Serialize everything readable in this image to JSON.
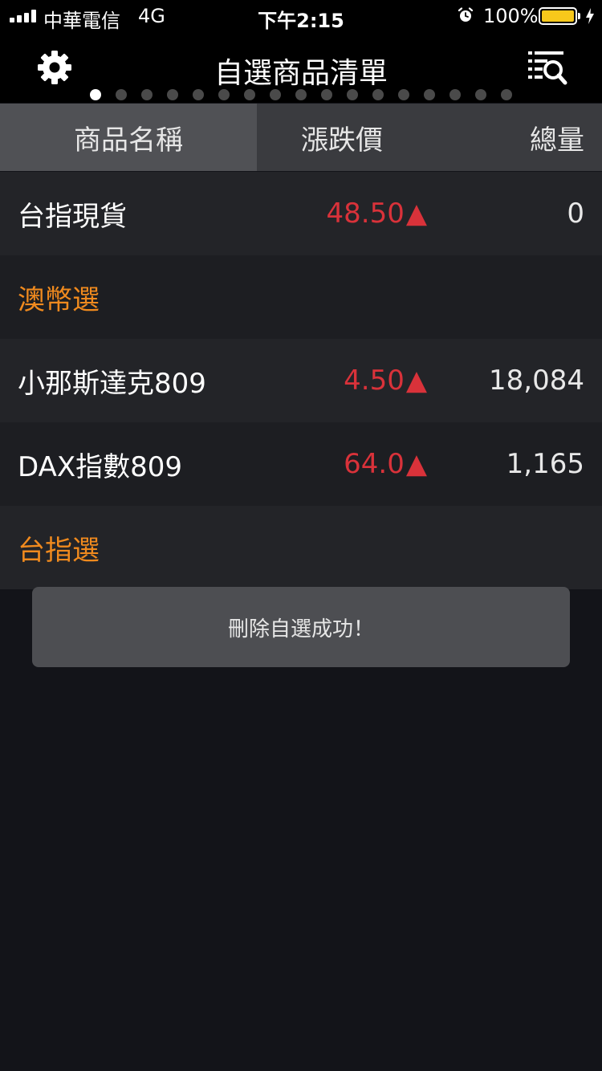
{
  "status_bar": {
    "carrier": "中華電信",
    "network": "4G",
    "time": "下午2:15",
    "battery_percent": "100%",
    "battery_color": "#f7c81b",
    "icons": [
      "signal-icon",
      "alarm-icon",
      "battery-icon",
      "charging-bolt-icon"
    ]
  },
  "nav": {
    "title": "自選商品清單",
    "left_icon": "gear-icon",
    "right_icon": "search-list-icon",
    "page_count": 17,
    "active_page": 1
  },
  "columns": {
    "name": "商品名稱",
    "change": "漲跌價",
    "volume": "總量"
  },
  "rows": [
    {
      "type": "item",
      "name": "台指現貨",
      "change": "48.50",
      "arrow": "▲",
      "volume": "0"
    },
    {
      "type": "group",
      "name": "澳幣選"
    },
    {
      "type": "item",
      "name": "小那斯達克809",
      "change": "4.50",
      "arrow": "▲",
      "volume": "18,084"
    },
    {
      "type": "item",
      "name": "DAX指數809",
      "change": "64.0",
      "arrow": "▲",
      "volume": "1,165"
    },
    {
      "type": "group",
      "name": "台指選"
    }
  ],
  "toast": {
    "message": "刪除自選成功！"
  },
  "colors": {
    "up": "#d9323a",
    "group": "#f08a1e",
    "background": "#131419"
  }
}
